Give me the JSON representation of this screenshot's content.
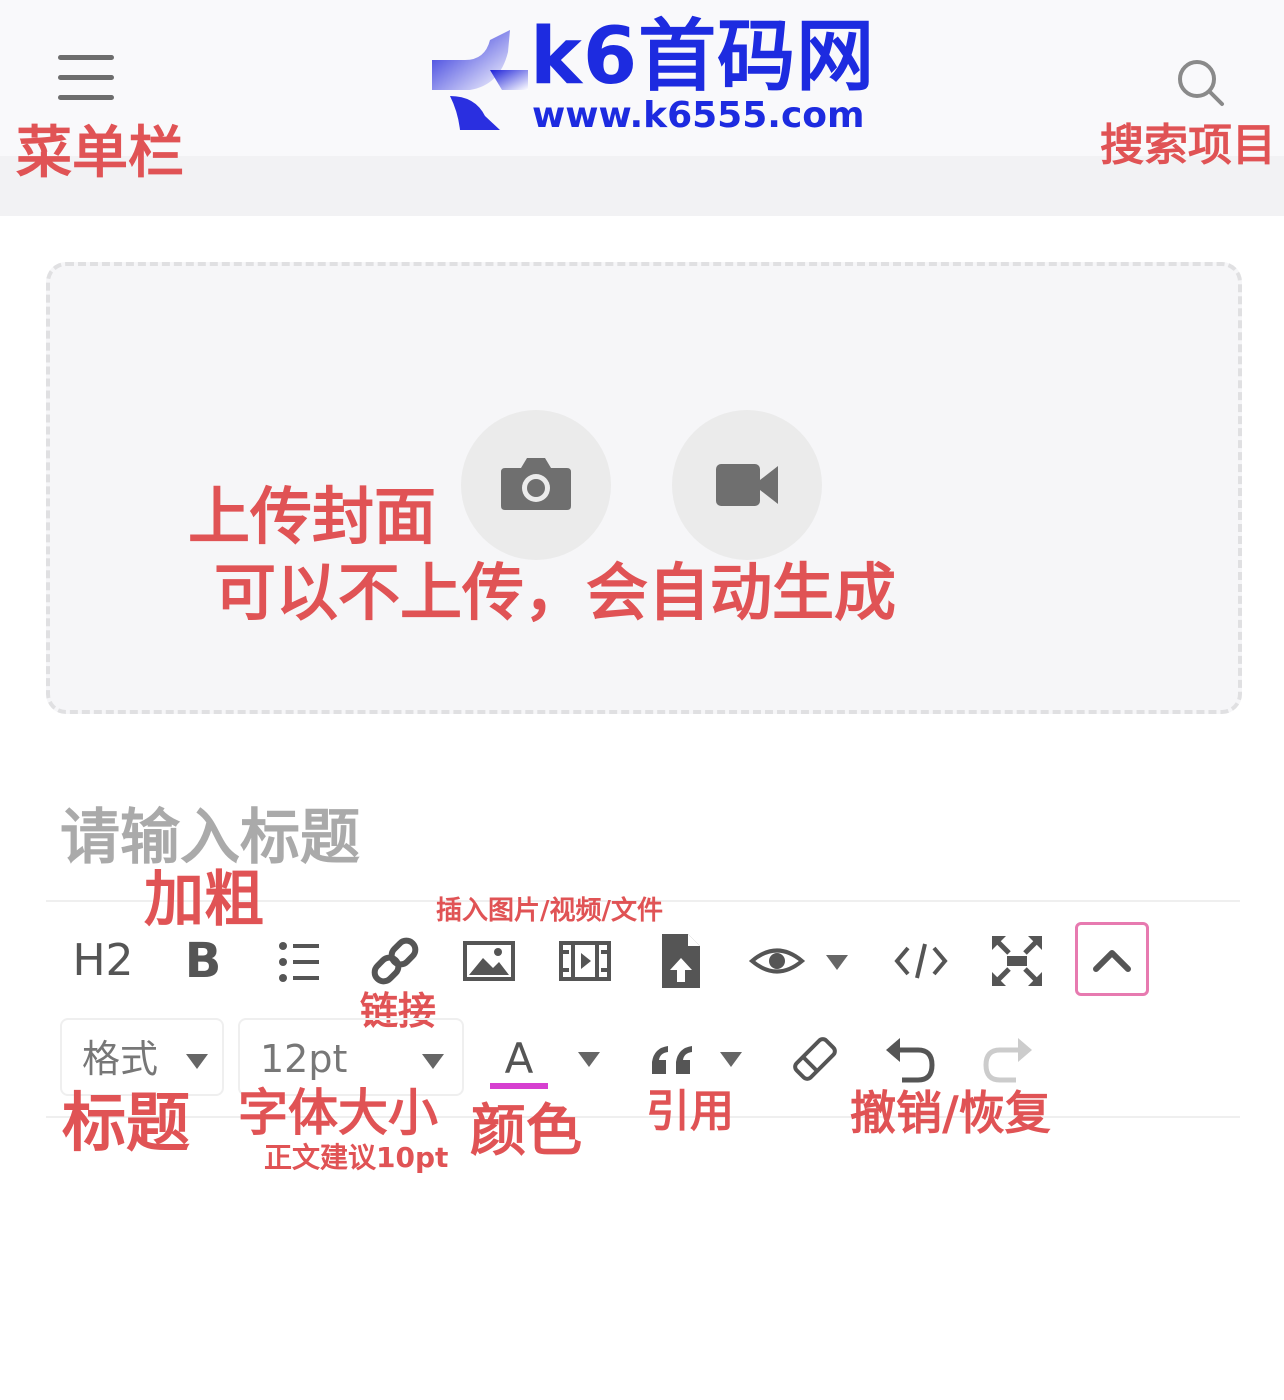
{
  "header": {
    "logo_name": "k6首码网",
    "logo_url": "www.k6555.com",
    "menu_annotation": "菜单栏",
    "search_annotation": "搜索项目"
  },
  "cover": {
    "annotation_line1": "上传封面",
    "annotation_line2": "可以不上传，会自动生成"
  },
  "title": {
    "placeholder": "请输入标题"
  },
  "toolbar": {
    "heading_label": "H2",
    "bold_label": "B",
    "format_select": "格式",
    "font_size_select": "12pt",
    "font_color_letter": "A",
    "font_color_value": "#d63fd0",
    "accent_border": "#e77ab0"
  },
  "annotations": {
    "bold": "加粗",
    "insert_media": "插入图片/视频/文件",
    "link": "链接",
    "heading_format": "标题",
    "font_size": "字体大小",
    "font_size_tip": "正文建议10pt",
    "color": "颜色",
    "quote": "引用",
    "undo_redo": "撤销/恢复",
    "annotation_color": "#e05355"
  }
}
